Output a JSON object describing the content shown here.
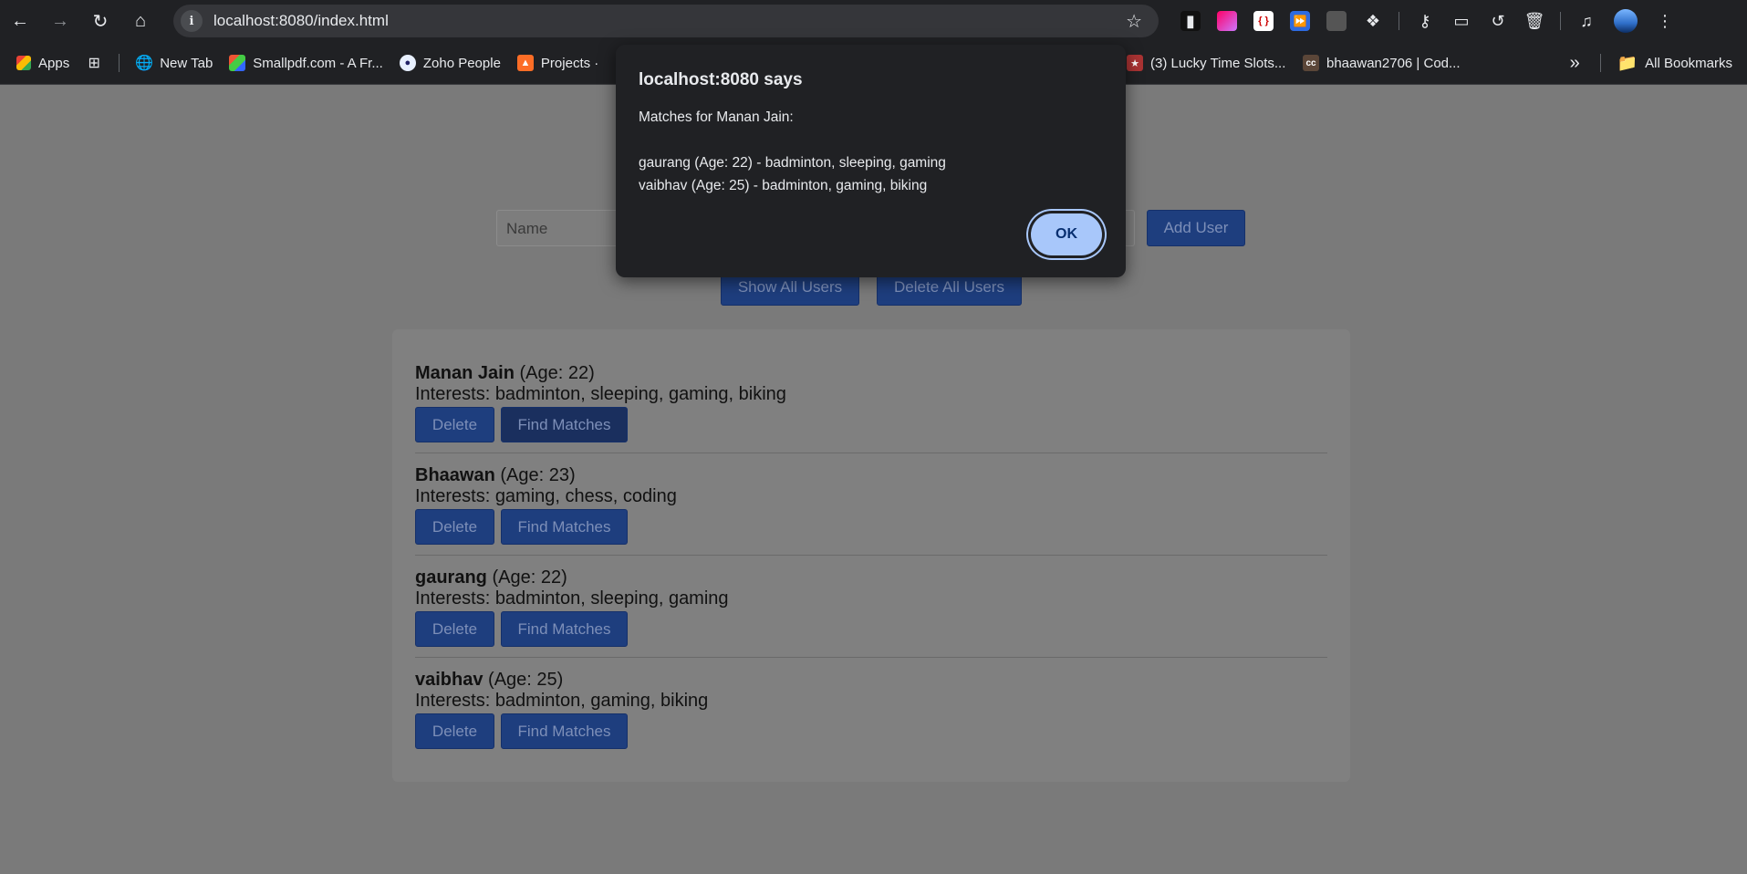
{
  "browser": {
    "url": "localhost:8080/index.html",
    "bookmarks": [
      {
        "label": "Apps",
        "icon": "apps-grid-icon"
      },
      {
        "label": "",
        "icon": "tab-groups-icon"
      },
      {
        "label": "New Tab",
        "icon": "globe-icon"
      },
      {
        "label": "Smallpdf.com - A Fr...",
        "icon": "smallpdf-icon"
      },
      {
        "label": "Zoho People",
        "icon": "zoho-icon"
      },
      {
        "label": "Projects ·",
        "icon": "gitlab-icon"
      }
    ],
    "bookmarks_right": [
      {
        "label": "(3) Lucky Time Slots...",
        "icon": "slots-icon"
      },
      {
        "label": "bhaawan2706 | Cod...",
        "icon": "codechef-icon"
      }
    ],
    "all_bookmarks": "All Bookmarks",
    "overflow": "»"
  },
  "form": {
    "name_placeholder": "Name",
    "add_user": "Add User",
    "show_all": "Show All Users",
    "delete_all": "Delete All Users"
  },
  "users": [
    {
      "name": "Manan Jain",
      "age": "(Age: 22)",
      "interests": "Interests: badminton, sleeping, gaming, biking"
    },
    {
      "name": "Bhaawan",
      "age": "(Age: 23)",
      "interests": "Interests: gaming, chess, coding"
    },
    {
      "name": "gaurang",
      "age": "(Age: 22)",
      "interests": "Interests: badminton, sleeping, gaming"
    },
    {
      "name": "vaibhav",
      "age": "(Age: 25)",
      "interests": "Interests: badminton, gaming, biking"
    }
  ],
  "user_buttons": {
    "delete": "Delete",
    "find": "Find Matches"
  },
  "dialog": {
    "title": "localhost:8080 says",
    "line1": "Matches for Manan Jain:",
    "line2": "",
    "line3": "gaurang (Age: 22) - badminton, sleeping, gaming",
    "line4": "vaibhav (Age: 25) - badminton, gaming, biking",
    "ok": "OK"
  },
  "colors": {
    "accent": "#a8c7fa",
    "button": "#1e3e7e",
    "chrome": "#202124"
  }
}
